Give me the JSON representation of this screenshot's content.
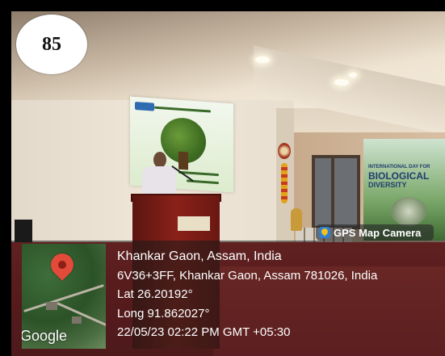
{
  "badge": {
    "number": "85"
  },
  "gps_tag": {
    "label": "GPS Map Camera",
    "icon": "gps-map-camera-logo-icon"
  },
  "map": {
    "watermark": "Google",
    "pin_icon": "location-pin-icon",
    "pin_color": "#e24a3a"
  },
  "location": {
    "place": "Khankar Gaon, Assam, India",
    "address": "6V36+3FF, Khankar Gaon, Assam 781026, India",
    "lat": "Lat 26.20192°",
    "long": "Long 91.862027°",
    "datetime": "22/05/23 02:22 PM GMT +05:30"
  },
  "banner": {
    "line1": "INTERNATIONAL DAY FOR",
    "line2": "BIOLOGICAL",
    "line3": "DIVERSITY"
  },
  "colors": {
    "stage": "#b62a2a",
    "overlay": "rgba(25,25,25,0.55)",
    "frame": "#000000"
  }
}
